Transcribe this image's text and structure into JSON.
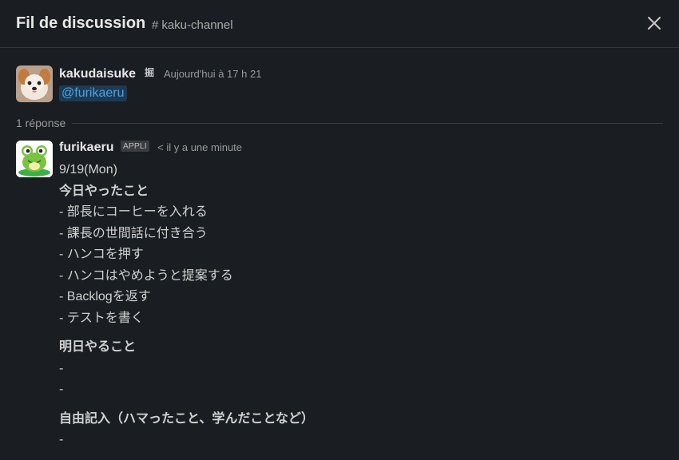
{
  "header": {
    "title": "Fil de discussion",
    "channel_hash": "#",
    "channel": "kaku-channel"
  },
  "parent": {
    "author": "kakudaisuke",
    "timestamp": "Aujourd'hui à 17 h 21",
    "mention": "@furikaeru"
  },
  "replies_label": "1 réponse",
  "reply": {
    "author": "furikaeru",
    "badge": "APPLI",
    "timestamp": "< il y a une minute",
    "date_line": "9/19(Mon)",
    "today_heading": "今日やったこと",
    "today_items": [
      "- 部長にコーヒーを入れる",
      "- 課長の世間話に付き合う",
      "- ハンコを押す",
      "- ハンコはやめようと提案する",
      "- Backlogを返す",
      "- テストを書く"
    ],
    "tomorrow_heading": "明日やること",
    "tomorrow_items": [
      "-",
      "-"
    ],
    "free_heading": "自由記入（ハマったこと、学んだことなど）",
    "free_items": [
      "-"
    ]
  },
  "colors": {
    "background": "#1a1d21",
    "mention_bg": "#1d3a54",
    "mention_fg": "#4ba3e3"
  }
}
